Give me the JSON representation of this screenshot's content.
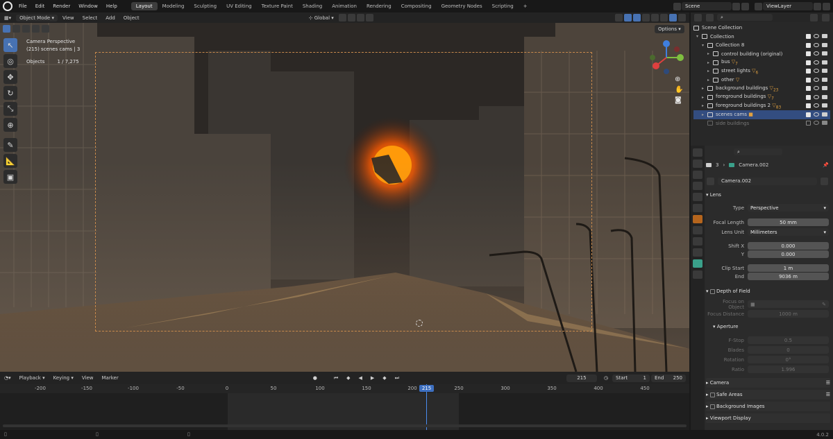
{
  "menu": {
    "items": [
      "File",
      "Edit",
      "Render",
      "Window",
      "Help"
    ],
    "workspaces": [
      "Layout",
      "Modeling",
      "Sculpting",
      "UV Editing",
      "Texture Paint",
      "Shading",
      "Animation",
      "Rendering",
      "Compositing",
      "Geometry Nodes",
      "Scripting"
    ],
    "active_workspace": "Layout",
    "add_tab": "+",
    "scene": "Scene",
    "view_layer": "ViewLayer"
  },
  "viewport_header": {
    "mode": "Object Mode",
    "menus": [
      "View",
      "Select",
      "Add",
      "Object"
    ],
    "orientation": "Global",
    "options": "Options"
  },
  "viewport": {
    "info_line1": "Camera Perspective",
    "info_line2": "(215) scenes cams | 3",
    "objects_label": "Objects",
    "objects_value": "1 / 7,275"
  },
  "outliner": {
    "root": "Scene Collection",
    "rows": [
      {
        "label": "Collection",
        "indent": 0,
        "badge": ""
      },
      {
        "label": "Collection 8",
        "indent": 1,
        "badge": ""
      },
      {
        "label": "control building (original)",
        "indent": 2,
        "badge": ""
      },
      {
        "label": "bus",
        "indent": 2,
        "badge": "7"
      },
      {
        "label": "street lights",
        "indent": 2,
        "badge": "6"
      },
      {
        "label": "other",
        "indent": 2,
        "badge": ""
      },
      {
        "label": "background buildings",
        "indent": 1,
        "badge": "23"
      },
      {
        "label": "foreground buildings",
        "indent": 1,
        "badge": "7"
      },
      {
        "label": "foreground buildings 2",
        "indent": 1,
        "badge": "83"
      },
      {
        "label": "scenes cams",
        "indent": 1,
        "badge": ""
      },
      {
        "label": "side buildings",
        "indent": 1,
        "badge": ""
      }
    ]
  },
  "properties": {
    "breadcrumb_num": "3",
    "breadcrumb_obj": "Camera.002",
    "data_name": "Camera.002",
    "lens_section": "Lens",
    "type_label": "Type",
    "type_value": "Perspective",
    "focal_label": "Focal Length",
    "focal_value": "50 mm",
    "lens_unit_label": "Lens Unit",
    "lens_unit_value": "Millimeters",
    "shift_x_label": "Shift X",
    "shift_x_value": "0.000",
    "shift_y_label": "Y",
    "shift_y_value": "0.000",
    "clip_start_label": "Clip Start",
    "clip_start_value": "1 m",
    "clip_end_label": "End",
    "clip_end_value": "9036 m",
    "dof_section": "Depth of Field",
    "focus_obj_label": "Focus on Object",
    "focus_dist_label": "Focus Distance",
    "focus_dist_value": "1000 m",
    "aperture_section": "Aperture",
    "fstop_label": "F-Stop",
    "fstop_value": "0.5",
    "blades_label": "Blades",
    "blades_value": "0",
    "rotation_label": "Rotation",
    "rotation_value": "0°",
    "ratio_label": "Ratio",
    "ratio_value": "1.996",
    "sections": [
      "Camera",
      "Safe Areas",
      "Background Images",
      "Viewport Display"
    ]
  },
  "timeline": {
    "menus": [
      "Playback",
      "Keying",
      "View",
      "Marker"
    ],
    "current_frame": "215",
    "start_label": "Start",
    "start_value": "1",
    "end_label": "End",
    "end_value": "250",
    "ticks": [
      "-200",
      "-150",
      "-100",
      "-50",
      "0",
      "50",
      "100",
      "150",
      "200",
      "250",
      "300",
      "350",
      "400",
      "450"
    ]
  },
  "status": {
    "version": "4.0.2"
  },
  "colors": {
    "accent": "#4772b3",
    "playhead": "#4a8cf0",
    "camera_frame": "#c98a4c"
  }
}
